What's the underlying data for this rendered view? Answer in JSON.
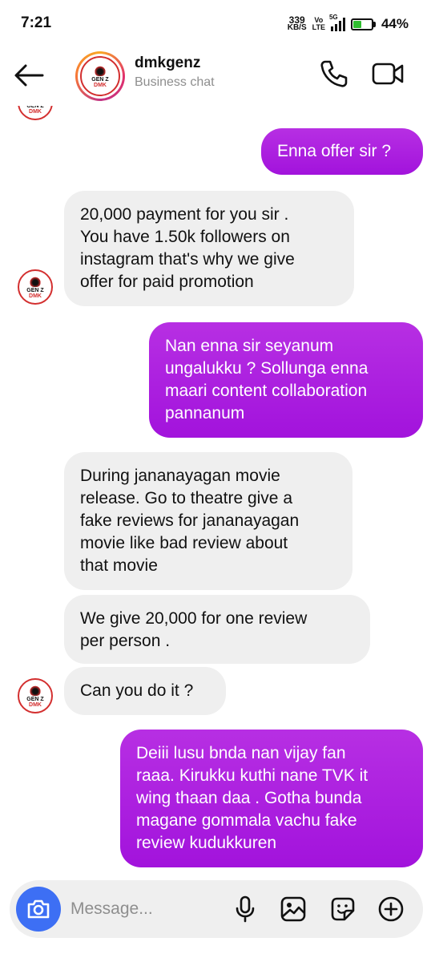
{
  "status_bar": {
    "time": "7:21",
    "net_speed_value": "339",
    "net_speed_unit": "KB/S",
    "volte_top": "Vo",
    "volte_bottom": "LTE",
    "network_type": "5G",
    "battery_percent": "44%",
    "battery_level": 0.44
  },
  "header": {
    "contact_name": "dmkgenz",
    "contact_subtitle": "Business chat",
    "logo_line1": "GEN Z",
    "logo_line2": "DMK",
    "icons": [
      "back-arrow-icon",
      "phone-icon",
      "video-camera-icon"
    ]
  },
  "messages": [
    {
      "direction": "out",
      "text": "Enna offer sir ?"
    },
    {
      "direction": "in",
      "text": "20,000 payment for you sir .\nYou have 1.50k followers on\ninstagram that's why we give\noffer for paid promotion"
    },
    {
      "direction": "out",
      "text": "Nan enna sir seyanum\nungalukku ? Sollunga enna\nmaari content collaboration\npannanum"
    },
    {
      "direction": "in",
      "text": "During jananayagan movie\nrelease. Go to theatre give a\nfake reviews for jananayagan\nmovie like bad review about\nthat movie"
    },
    {
      "direction": "in",
      "text": "We give 20,000 for one review\nper person ."
    },
    {
      "direction": "in",
      "text": "Can you do it ?"
    },
    {
      "direction": "out",
      "text": "Deiii lusu bnda nan vijay fan\nraaa. Kirukku kuthi nane TVK it\nwing thaan daa . Gotha bunda\nmagane gommala vachu fake\nreview kudukkuren"
    }
  ],
  "composer": {
    "placeholder": "Message...",
    "icons": [
      "camera-icon",
      "microphone-icon",
      "gallery-icon",
      "sticker-icon",
      "plus-icon"
    ]
  },
  "colors": {
    "outgoing_bubble": "#a817df",
    "incoming_bubble": "#efefef",
    "camera_button": "#3d6ff4"
  }
}
